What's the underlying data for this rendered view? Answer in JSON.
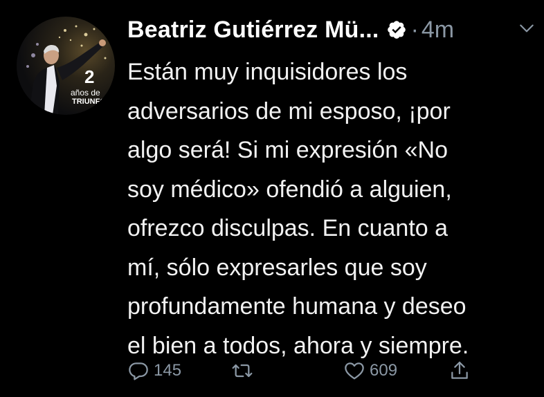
{
  "tweet": {
    "author_name": "Beatriz Gutiérrez Mü...",
    "time_separator": "·",
    "time": "4m",
    "avatar_text": {
      "number": "2",
      "line1": "años de",
      "line2": "TRIUNFO"
    },
    "body_lines": [
      "Están muy inquisidores los",
      "adversarios de mi esposo, ¡por",
      "algo será! Si mi expresión «No",
      "soy médico» ofendió a alguien,",
      "ofrezco disculpas. En cuanto a",
      "mí, sólo expresarles que soy",
      "profundamente humana y deseo",
      "el bien a todos, ahora y siempre."
    ],
    "actions": {
      "reply_count": "145",
      "retweet_count": "",
      "like_count": "609"
    }
  },
  "icons": {
    "verified": "verified-badge-icon",
    "more": "chevron-down-icon",
    "reply": "reply-icon",
    "retweet": "retweet-icon",
    "like": "heart-icon",
    "share": "share-icon"
  },
  "colors": {
    "background": "#000000",
    "text": "#f2f2f2",
    "secondary": "#8b98a5"
  }
}
